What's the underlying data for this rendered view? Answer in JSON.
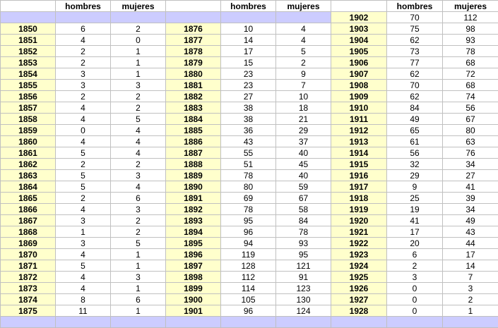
{
  "header": {
    "hombres": "hombres",
    "mujeres": "mujeres"
  },
  "top_row": {
    "year": "1902",
    "hombres": "70",
    "mujeres": "112"
  },
  "rows": [
    {
      "y1": "1850",
      "h1": "6",
      "m1": "2",
      "y2": "1876",
      "h2": "10",
      "m2": "4",
      "y3": "1903",
      "h3": "75",
      "m3": "98"
    },
    {
      "y1": "1851",
      "h1": "4",
      "m1": "0",
      "y2": "1877",
      "h2": "14",
      "m2": "4",
      "y3": "1904",
      "h3": "62",
      "m3": "93"
    },
    {
      "y1": "1852",
      "h1": "2",
      "m1": "1",
      "y2": "1878",
      "h2": "17",
      "m2": "5",
      "y3": "1905",
      "h3": "73",
      "m3": "78"
    },
    {
      "y1": "1853",
      "h1": "2",
      "m1": "1",
      "y2": "1879",
      "h2": "15",
      "m2": "2",
      "y3": "1906",
      "h3": "77",
      "m3": "68"
    },
    {
      "y1": "1854",
      "h1": "3",
      "m1": "1",
      "y2": "1880",
      "h2": "23",
      "m2": "9",
      "y3": "1907",
      "h3": "62",
      "m3": "72"
    },
    {
      "y1": "1855",
      "h1": "3",
      "m1": "3",
      "y2": "1881",
      "h2": "23",
      "m2": "7",
      "y3": "1908",
      "h3": "70",
      "m3": "68"
    },
    {
      "y1": "1856",
      "h1": "2",
      "m1": "2",
      "y2": "1882",
      "h2": "27",
      "m2": "10",
      "y3": "1909",
      "h3": "62",
      "m3": "74"
    },
    {
      "y1": "1857",
      "h1": "4",
      "m1": "2",
      "y2": "1883",
      "h2": "38",
      "m2": "18",
      "y3": "1910",
      "h3": "84",
      "m3": "56"
    },
    {
      "y1": "1858",
      "h1": "4",
      "m1": "5",
      "y2": "1884",
      "h2": "38",
      "m2": "21",
      "y3": "1911",
      "h3": "49",
      "m3": "67"
    },
    {
      "y1": "1859",
      "h1": "0",
      "m1": "4",
      "y2": "1885",
      "h2": "36",
      "m2": "29",
      "y3": "1912",
      "h3": "65",
      "m3": "80"
    },
    {
      "y1": "1860",
      "h1": "4",
      "m1": "4",
      "y2": "1886",
      "h2": "43",
      "m2": "37",
      "y3": "1913",
      "h3": "61",
      "m3": "63"
    },
    {
      "y1": "1861",
      "h1": "5",
      "m1": "4",
      "y2": "1887",
      "h2": "55",
      "m2": "40",
      "y3": "1914",
      "h3": "56",
      "m3": "76"
    },
    {
      "y1": "1862",
      "h1": "2",
      "m1": "2",
      "y2": "1888",
      "h2": "51",
      "m2": "45",
      "y3": "1915",
      "h3": "32",
      "m3": "34"
    },
    {
      "y1": "1863",
      "h1": "5",
      "m1": "3",
      "y2": "1889",
      "h2": "78",
      "m2": "40",
      "y3": "1916",
      "h3": "29",
      "m3": "27"
    },
    {
      "y1": "1864",
      "h1": "5",
      "m1": "4",
      "y2": "1890",
      "h2": "80",
      "m2": "59",
      "y3": "1917",
      "h3": "9",
      "m3": "41"
    },
    {
      "y1": "1865",
      "h1": "2",
      "m1": "6",
      "y2": "1891",
      "h2": "69",
      "m2": "67",
      "y3": "1918",
      "h3": "25",
      "m3": "39"
    },
    {
      "y1": "1866",
      "h1": "4",
      "m1": "3",
      "y2": "1892",
      "h2": "78",
      "m2": "58",
      "y3": "1919",
      "h3": "19",
      "m3": "34"
    },
    {
      "y1": "1867",
      "h1": "3",
      "m1": "2",
      "y2": "1893",
      "h2": "95",
      "m2": "84",
      "y3": "1920",
      "h3": "41",
      "m3": "49"
    },
    {
      "y1": "1868",
      "h1": "1",
      "m1": "2",
      "y2": "1894",
      "h2": "96",
      "m2": "78",
      "y3": "1921",
      "h3": "17",
      "m3": "43"
    },
    {
      "y1": "1869",
      "h1": "3",
      "m1": "5",
      "y2": "1895",
      "h2": "94",
      "m2": "93",
      "y3": "1922",
      "h3": "20",
      "m3": "44"
    },
    {
      "y1": "1870",
      "h1": "4",
      "m1": "1",
      "y2": "1896",
      "h2": "119",
      "m2": "95",
      "y3": "1923",
      "h3": "6",
      "m3": "17"
    },
    {
      "y1": "1871",
      "h1": "5",
      "m1": "1",
      "y2": "1897",
      "h2": "128",
      "m2": "121",
      "y3": "1924",
      "h3": "2",
      "m3": "14"
    },
    {
      "y1": "1872",
      "h1": "4",
      "m1": "3",
      "y2": "1898",
      "h2": "112",
      "m2": "91",
      "y3": "1925",
      "h3": "3",
      "m3": "7"
    },
    {
      "y1": "1873",
      "h1": "4",
      "m1": "1",
      "y2": "1899",
      "h2": "114",
      "m2": "123",
      "y3": "1926",
      "h3": "0",
      "m3": "3"
    },
    {
      "y1": "1874",
      "h1": "8",
      "m1": "6",
      "y2": "1900",
      "h2": "105",
      "m2": "130",
      "y3": "1927",
      "h3": "0",
      "m3": "2"
    },
    {
      "y1": "1875",
      "h1": "11",
      "m1": "1",
      "y2": "1901",
      "h2": "96",
      "m2": "124",
      "y3": "1928",
      "h3": "0",
      "m3": "1"
    }
  ],
  "colors": {
    "year_cell": "#ffffcc",
    "band": "#ccccff",
    "grid": "#c0c0c0"
  }
}
